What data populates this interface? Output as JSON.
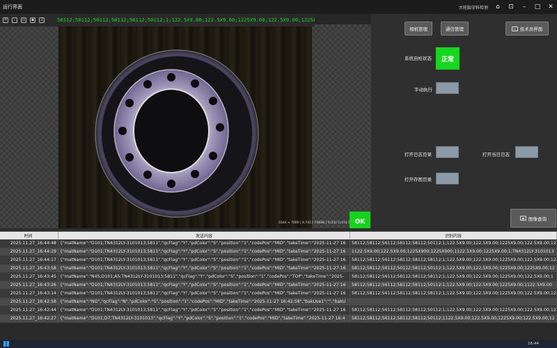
{
  "window": {
    "title": "运行界面",
    "company": "大轮胎宇科检测",
    "icons": [
      "home-icon",
      "lock-icon",
      "minimize-icon",
      "maximize-icon",
      "close-icon"
    ]
  },
  "viewer": {
    "toolbar_icons": [
      "zoom-in-icon",
      "zoom-out-icon",
      "fit-icon",
      "crop-icon",
      "save-icon"
    ],
    "code_text": "58112;58112;56112;58112;58112;50112;1;122.5X9.00;122.5X9.00;1225X9.00;122.5X9.00;1225X9.00;122...",
    "status_line": "5544 × 7000  |  X:7417  Y:6690  |  R:032  G:031  B:038",
    "ok_label": "OK",
    "ok_color": "#16d41e"
  },
  "panel": {
    "camera_mgmt": "相机管理",
    "comm_mgmt": "通信管理",
    "tech_ui": "技术员界面",
    "system_status_label": "系统自检状态",
    "system_status_value": "正常",
    "status_color": "#18d71f",
    "manual_exec": "手动执行",
    "open_log_dir": "打开日志目录",
    "open_today_log": "打开当日日志",
    "open_image_dir": "打开存图目录",
    "image_query": "图像查询"
  },
  "table": {
    "headers": [
      "时间",
      "发送内容",
      "识别内容"
    ],
    "rows": [
      [
        "2025.11.27_16:44:48",
        "{\"matName\":\"D101;TN4312LY-3101013;5811\",\"qcFlag\":\"Y\",\"pdColor\":\"S\",\"position\":\"1\",\"codePos\":\"MID\",\"takeTime\":\"2025-11-27 16",
        "58112;58112;56112;58112;58112;50112;1;122.5X9.00;122.5X9.00;1225X9.00;122.5X9.00;12"
      ],
      [
        "2025.11.27_16:44:29",
        "{\"matName\":\"D101;TN4312LY-3101013;5811\",\"qcFlag\":\"Y\",\"pdColor\":\"S\",\"position\":\"1\",\"codePos\":\"MID\",\"takeTime\":\"2025-11-27 16",
        "1122.5X9.00;122.5X9.00;1225X900;1225X900;1122.5X9.00;1225X9.00;1;TN4312LY-3101013"
      ],
      [
        "2025.11.27_16:44:17",
        "{\"matName\":\"D101;TN4312LY-3101013;5811\",\"qcFlag\":\"Y\",\"pdColor\":\"S\",\"position\":\"1\",\"codePos\":\"MID\",\"takeTime\":\"2025-11-27 16",
        "58112;58112;56112;58112;58112;58112;1;122.5X9.00;122.5X9.00;1225X9.00;122.5X9.00;12"
      ],
      [
        "2025.11.27_16:43:58",
        "{\"matName\":\"D101;TN4312LY-3101013;5811\",\"qcFlag\":\"Y\",\"pdColor\":\"S\",\"position\":\"1\",\"codePos\":\"MID\",\"takeTime\":\"2025-11-27 16",
        "58112;58112;56112;50112;58112;50112;1;122.5X9.00;122.5X9.00;1225X9.00;1225X9.00;12"
      ],
      [
        "2025.11.27_16:43:45",
        "{\"matName\":\"N45;D101;A5;TN4312LY-3101013;5811\",\"qcFlag\":\"Y\",\"pdColor\":\"S\",\"position\":\"1\",\"codePos\":\"TOP\",\"takeTime\":\"2025-",
        "58112;58112;56112;58112;58112;58112;1;122.5X9.00;122.5X9.00;1225X9.00;122.5X9.00;1"
      ],
      [
        "2025.11.27_16:43:26",
        "{\"matName\":\"D101;TN4312LY-3101013;5811\",\"qcFlag\":\"Y\",\"pdColor\":\"S\",\"position\":\"1\",\"codePos\":\"MID\",\"takeTime\":\"2025-11-27 16",
        "58112;58112;56112;58112;58112;50112;1;122.5X9.00;122.5X9.00;1225X9.00;1122.5X9.00"
      ],
      [
        "2025.11.27_16:43:14",
        "{\"matName\":\"D101;TN4312LY-3101013;5811\",\"qcFlag\":\"Y\",\"pdColor\":\"S\",\"position\":\"1\",\"codePos\":\"MID\",\"takeTime\":\"2025-11-27 16",
        "58112;58112;56112;58112;58112;58112;1;122.5X9.00;122.5X9.00;1225X9.00;122.5X9.00;12"
      ],
      [
        "2025.11.27_16:42:58",
        "{\"matName\":\"NG\",\"qcFlag\":\"N\",\"pdColor\":\"S\",\"position\":\"1\",\"codePos\":\"MID\",\"takeTime\":\"2025-11-27 16:42:58\",\"bakUse1\":\"\",\"bakU",
        ""
      ],
      [
        "2025.11.27_16:42:44",
        "{\"matName\":\"D101;TN4312LY-3101013;5811\",\"qcFlag\":\"Y\",\"pdColor\":\"S\",\"position\":\"1\",\"codePos\":\"MID\",\"takeTime\":\"2025-11-27 16",
        "58112;58112;56112;58112;58112;50112;1;122.5X9.00;122.5X9.00;1225X9.00;122.5X9.00;12"
      ],
      [
        "2025.11.27_16:42:27",
        "{\"matName\":\"D101;D7;TN4312LY-3101013\",\"qcFlag\":\"Y\",\"pdColor\":\"S\",\"position\":\"1\",\"codePos\":\"MID\",\"takeTime\":\"2025-11-27 16:4",
        "58112;58112;56112;58112;58112;50112;1122.5X9.00;122.5X9.00;1225X9.00;122.5X9.00;12"
      ]
    ]
  },
  "taskbar": {
    "time": "16:44"
  }
}
